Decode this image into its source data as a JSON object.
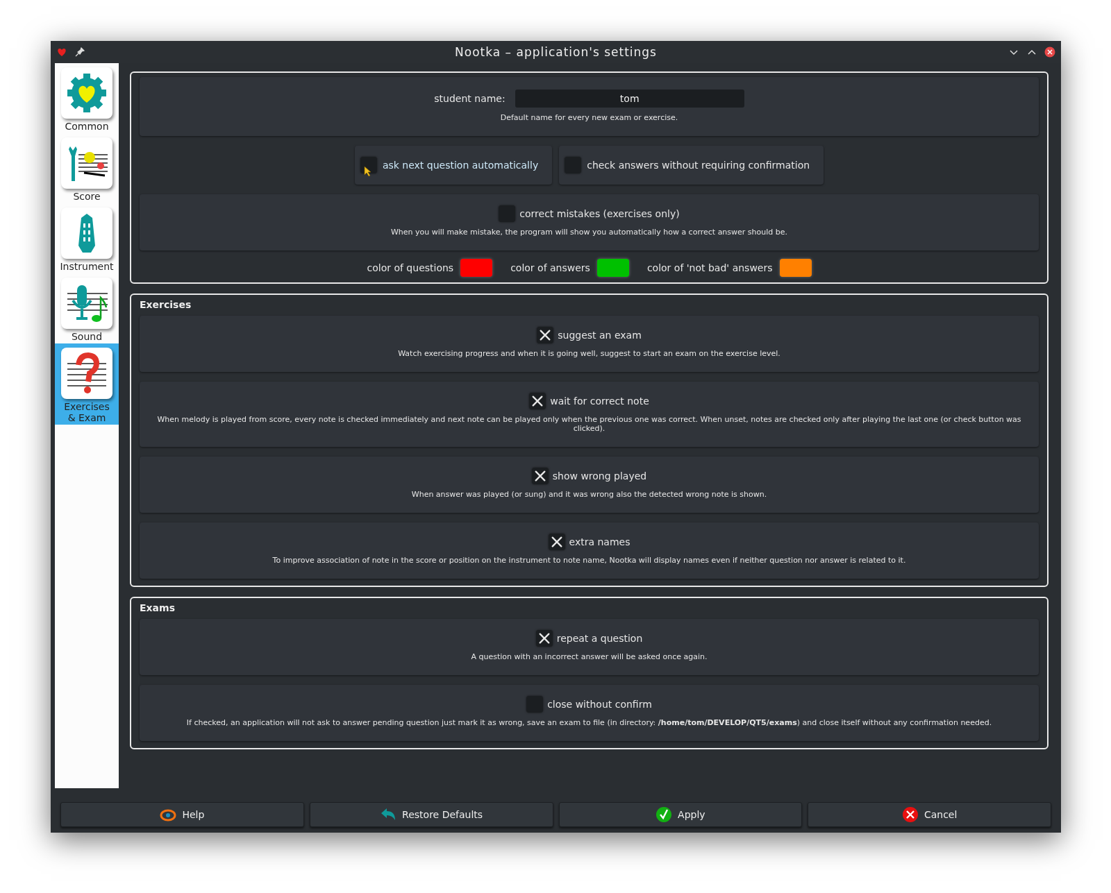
{
  "window": {
    "title": "Nootka – application's settings"
  },
  "sidebar": {
    "items": [
      {
        "label": "Common",
        "kind": "common",
        "selected": false
      },
      {
        "label": "Score",
        "kind": "score",
        "selected": false
      },
      {
        "label": "Instrument",
        "kind": "instrument",
        "selected": false
      },
      {
        "label": "Sound",
        "kind": "sound",
        "selected": false
      },
      {
        "label": "Exercises\n& Exam",
        "kind": "exam",
        "selected": true
      }
    ]
  },
  "general": {
    "student_name": {
      "label": "student name:",
      "value": "tom",
      "hint": "Default name for every new exam or exercise."
    },
    "toggles": [
      {
        "label": "ask next question automatically",
        "checked": false
      },
      {
        "label": "check answers without requiring confirmation",
        "checked": false
      }
    ],
    "correct_mistakes": {
      "label": "correct mistakes (exercises only)",
      "checked": false,
      "description": "When you will make mistake, the program will show you automatically how a correct answer should be."
    },
    "colors": [
      {
        "label": "color of questions",
        "color": "#ff0000"
      },
      {
        "label": "color of answers",
        "color": "#00c000"
      },
      {
        "label": "color of 'not bad' answers",
        "color": "#ff8000"
      }
    ]
  },
  "exercises": {
    "title": "Exercises",
    "options": [
      {
        "label": "suggest an exam",
        "checked": true,
        "description": "Watch exercising progress and when it is going well, suggest to start an exam on the exercise level."
      },
      {
        "label": "wait for correct note",
        "checked": true,
        "description": "When melody is played from score, every note is checked immediately and next note can be played only when the previous one was correct. When unset, notes are checked only after playing the last one (or check button was clicked)."
      },
      {
        "label": "show wrong played",
        "checked": true,
        "description": "When answer was played (or sung) and it was wrong also the detected wrong note is shown."
      },
      {
        "label": "extra names",
        "checked": true,
        "description": "To improve association of note in the score or position on the instrument to note name, Nootka will display names even if neither question nor answer is related to it."
      }
    ]
  },
  "exams": {
    "title": "Exams",
    "options": [
      {
        "label": "repeat a question",
        "checked": true,
        "description": "A question with an incorrect answer will be asked once again."
      },
      {
        "label": "close without confirm",
        "checked": false,
        "description": "If checked, an application will not ask to answer pending question just mark it as wrong, save an exam to file (in directory: **/home/tom/DEVELOP/QT5/exams**) and close itself without any confirmation needed."
      }
    ]
  },
  "buttons": [
    {
      "label": "Help",
      "kind": "help"
    },
    {
      "label": "Restore Defaults",
      "kind": "restore"
    },
    {
      "label": "Apply",
      "kind": "apply"
    },
    {
      "label": "Cancel",
      "kind": "cancel"
    }
  ]
}
